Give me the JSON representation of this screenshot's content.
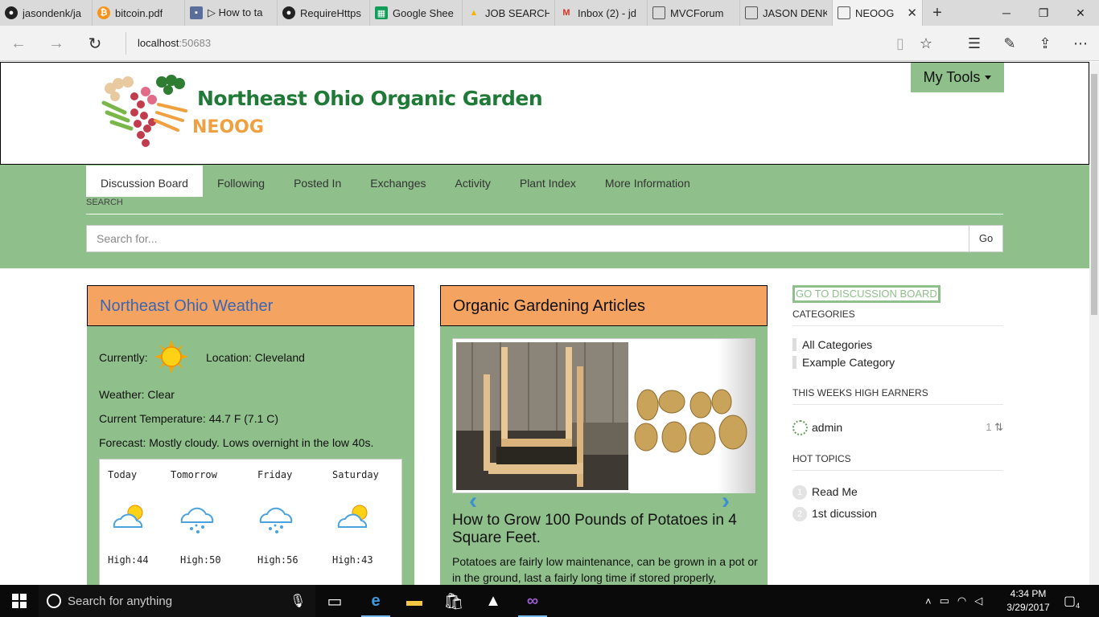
{
  "browser": {
    "tabs": [
      {
        "title": "jasondenk/ja",
        "icon": "github-icon"
      },
      {
        "title": "bitcoin.pdf",
        "icon": "bitcoin-icon"
      },
      {
        "title": "▷ How to ta",
        "icon": "video-icon"
      },
      {
        "title": "RequireHttps",
        "icon": "github-icon"
      },
      {
        "title": "Google Shee",
        "icon": "sheets-icon"
      },
      {
        "title": "JOB SEARCH",
        "icon": "drive-icon"
      },
      {
        "title": "Inbox (2) - jd",
        "icon": "gmail-icon"
      },
      {
        "title": "MVCForum",
        "icon": "page-icon"
      },
      {
        "title": "JASON DENK",
        "icon": "page-icon"
      }
    ],
    "active_tab": {
      "title": "NEOOG",
      "close": "✕"
    },
    "new_tab": "+",
    "url_host": "localhost",
    "url_port": ":50683"
  },
  "header": {
    "title": "Northeast Ohio Organic Garden",
    "abbr": "NEOOG",
    "my_tools": "My Tools"
  },
  "nav": {
    "tabs": [
      "Discussion Board",
      "Following",
      "Posted In",
      "Exchanges",
      "Activity",
      "Plant Index",
      "More Information"
    ],
    "active": "Discussion Board"
  },
  "search": {
    "label": "SEARCH",
    "placeholder": "Search for...",
    "button": "Go"
  },
  "weather": {
    "heading": "Northeast Ohio Weather",
    "currently_label": "Currently:",
    "location": "Location: Cleveland",
    "condition": "Weather: Clear",
    "temperature": "Current Temperature: 44.7 F (7.1 C)",
    "forecast_text": "Forecast: Mostly cloudy. Lows overnight in the low 40s.",
    "days": [
      {
        "name": "Today",
        "icon": "partly-sunny-icon",
        "high": "High:44"
      },
      {
        "name": "Tomorrow",
        "icon": "rain-cloud-icon",
        "high": "High:50"
      },
      {
        "name": "Friday",
        "icon": "rain-cloud-icon",
        "high": "High:56"
      },
      {
        "name": "Saturday",
        "icon": "partly-sunny-icon",
        "high": "High:43"
      }
    ]
  },
  "articles": {
    "heading": "Organic Gardening Articles",
    "title": "How to Grow 100 Pounds of Potatoes in 4 Square Feet.",
    "text": "Potatoes are fairly low maintenance, can be grown in a pot or in the ground, last a fairly long time if stored properly,"
  },
  "sidebar": {
    "goto": "GO TO DISCUSSION BOARD",
    "categories_heading": "CATEGORIES",
    "categories": [
      "All Categories",
      "Example Category"
    ],
    "earners_heading": "THIS WEEKS HIGH EARNERS",
    "earners": [
      {
        "name": "admin",
        "points": "1"
      }
    ],
    "topics_heading": "HOT TOPICS",
    "topics": [
      {
        "num": "1",
        "title": "Read Me"
      },
      {
        "num": "2",
        "title": "1st dicussion"
      }
    ]
  },
  "taskbar": {
    "search_placeholder": "Search for anything",
    "time": "4:34 PM",
    "date": "3/29/2017",
    "notifications": "4"
  },
  "colors": {
    "brand_green": "#8fbf8a",
    "panel_orange": "#f4a460",
    "title_green": "#1f7a37",
    "abbr_orange": "#f0a040",
    "link_blue": "#3a66b5"
  }
}
